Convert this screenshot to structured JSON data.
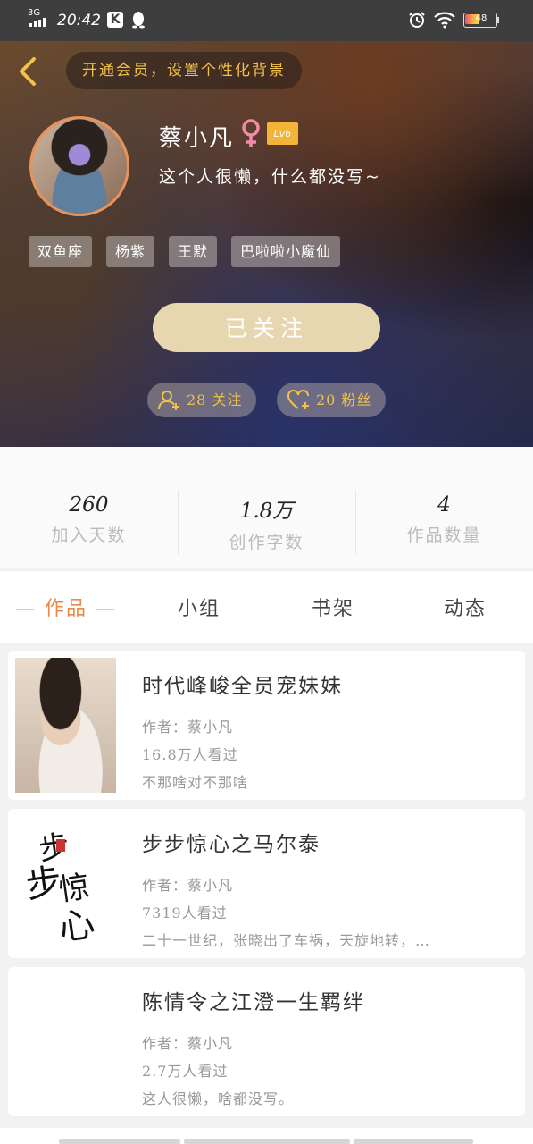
{
  "status_bar": {
    "network": "3G",
    "time": "20:42",
    "battery": "48"
  },
  "header": {
    "vip_prompt": "开通会员，设置个性化背景",
    "username": "蔡小凡",
    "level": "Lv6",
    "bio": "这个人很懒，什么都没写~",
    "tags": [
      "双鱼座",
      "杨紫",
      "王默",
      "巴啦啦小魔仙"
    ],
    "follow_button": "已关注",
    "following_label": "28 关注",
    "fans_label": "20 粉丝"
  },
  "stats": [
    {
      "value": "260",
      "label": "加入天数"
    },
    {
      "value": "1.8万",
      "label": "创作字数"
    },
    {
      "value": "4",
      "label": "作品数量"
    }
  ],
  "tabs": [
    {
      "label": "— 作品 —",
      "active": true
    },
    {
      "label": "小组",
      "active": false
    },
    {
      "label": "书架",
      "active": false
    },
    {
      "label": "动态",
      "active": false
    }
  ],
  "works": [
    {
      "title": "时代峰峻全员宠妹妹",
      "author": "作者：蔡小凡",
      "views": "16.8万人看过",
      "summary": "不那啥对不那啥"
    },
    {
      "title": "步步惊心之马尔泰",
      "author": "作者：蔡小凡",
      "views": "7319人看过",
      "summary": "二十一世纪，张晓出了车祸，天旋地转，…",
      "cover_text": "步步惊心"
    },
    {
      "title": "陈情令之江澄一生羁绊",
      "author": "作者：蔡小凡",
      "views": "2.7万人看过",
      "summary": "这人很懒，啥都没写。"
    }
  ],
  "colors": {
    "accent": "#e8894b",
    "gold": "#f1c24b",
    "follow_button": "#e6d7b0",
    "level_badge": "#f3b43a",
    "gender_pink": "#f08aa8"
  }
}
